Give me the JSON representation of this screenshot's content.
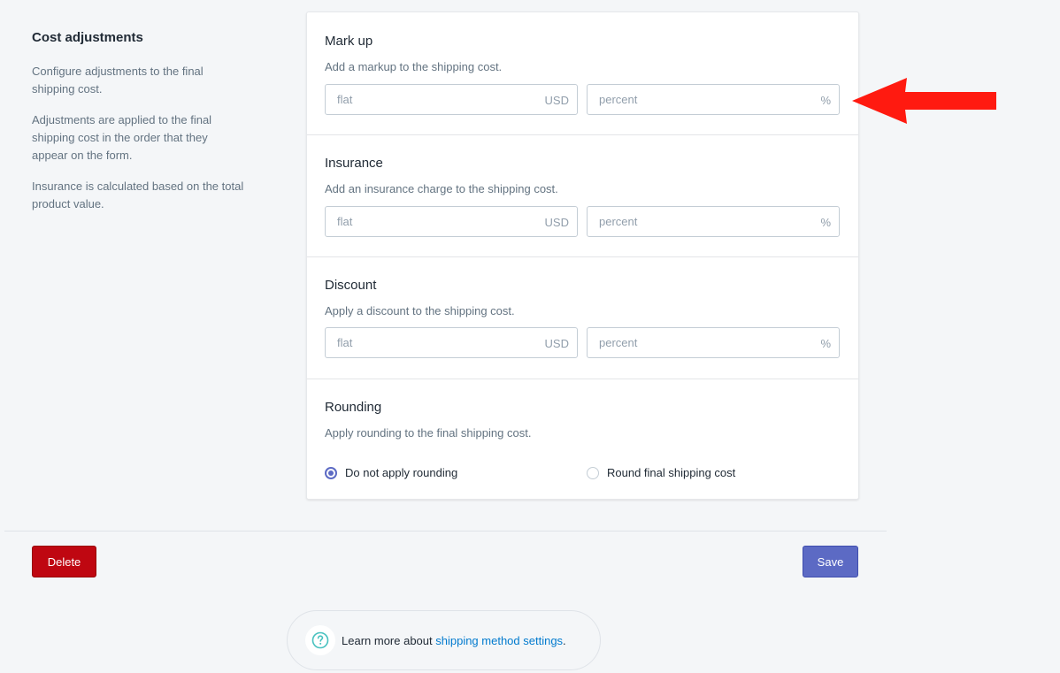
{
  "intro": {
    "title": "Cost adjustments",
    "paragraphs": [
      "Configure adjustments to the final shipping cost.",
      "Adjustments are applied to the final shipping cost in the order that they appear on the form.",
      "Insurance is calculated based on the total product value."
    ]
  },
  "sections": {
    "markup": {
      "title": "Mark up",
      "description": "Add a markup to the shipping cost.",
      "flat": {
        "placeholder": "flat",
        "value": "",
        "suffix": "USD"
      },
      "percent": {
        "placeholder": "percent",
        "value": "",
        "suffix": "%"
      }
    },
    "insurance": {
      "title": "Insurance",
      "description": "Add an insurance charge to the shipping cost.",
      "flat": {
        "placeholder": "flat",
        "value": "",
        "suffix": "USD"
      },
      "percent": {
        "placeholder": "percent",
        "value": "",
        "suffix": "%"
      }
    },
    "discount": {
      "title": "Discount",
      "description": "Apply a discount to the shipping cost.",
      "flat": {
        "placeholder": "flat",
        "value": "",
        "suffix": "USD"
      },
      "percent": {
        "placeholder": "percent",
        "value": "",
        "suffix": "%"
      }
    },
    "rounding": {
      "title": "Rounding",
      "description": "Apply rounding to the final shipping cost.",
      "options": [
        {
          "label": "Do not apply rounding",
          "selected": true
        },
        {
          "label": "Round final shipping cost",
          "selected": false
        }
      ]
    }
  },
  "actions": {
    "delete_label": "Delete",
    "save_label": "Save"
  },
  "help": {
    "prefix": "Learn more about ",
    "link_text": "shipping method settings",
    "suffix": "."
  },
  "annotation": {
    "icon": "arrow-left-icon",
    "color": "#ff1a10"
  },
  "colors": {
    "primary": "#5c6ac4",
    "destructive": "#bf0711",
    "link": "#007ace"
  }
}
